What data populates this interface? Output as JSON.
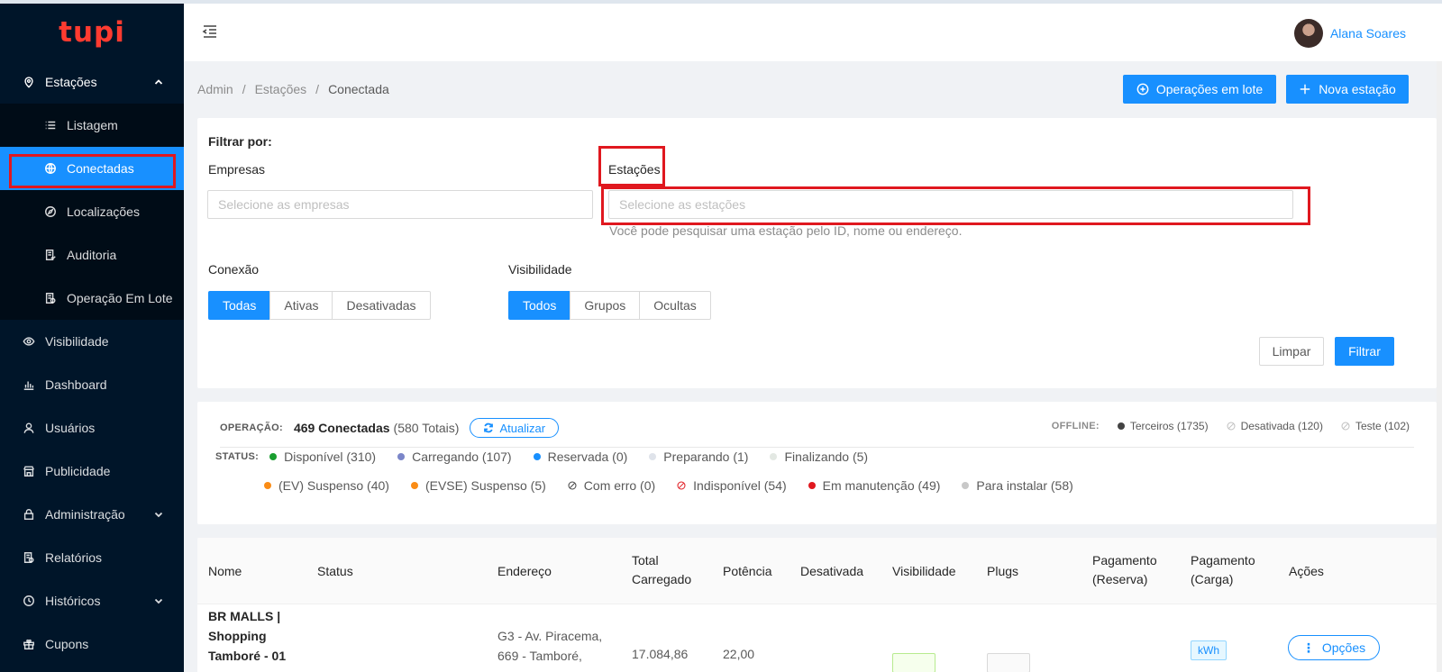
{
  "brand": {
    "logo_text": "tupi"
  },
  "sidebar": {
    "items": [
      {
        "label": "Estações",
        "icon": "location-pin-icon"
      },
      {
        "label": "Listagem",
        "icon": "list-icon"
      },
      {
        "label": "Conectadas",
        "icon": "globe-icon"
      },
      {
        "label": "Localizações",
        "icon": "compass-icon"
      },
      {
        "label": "Auditoria",
        "icon": "audit-doc-icon"
      },
      {
        "label": "Operação Em Lote",
        "icon": "batch-doc-icon"
      },
      {
        "label": "Visibilidade",
        "icon": "eye-icon"
      },
      {
        "label": "Dashboard",
        "icon": "bar-chart-icon"
      },
      {
        "label": "Usuários",
        "icon": "user-icon"
      },
      {
        "label": "Publicidade",
        "icon": "shop-icon"
      },
      {
        "label": "Administração",
        "icon": "lock-icon"
      },
      {
        "label": "Relatórios",
        "icon": "report-icon"
      },
      {
        "label": "Históricos",
        "icon": "history-icon"
      },
      {
        "label": "Cupons",
        "icon": "gift-icon"
      }
    ]
  },
  "header": {
    "user_name": "Alana Soares"
  },
  "breadcrumb": {
    "admin": "Admin",
    "sep": "/",
    "stations": "Estações",
    "current": "Conectada"
  },
  "actions": {
    "batch_ops": "Operações em lote",
    "new_station": "Nova estação"
  },
  "filter": {
    "title": "Filtrar por:",
    "companies_label": "Empresas",
    "companies_placeholder": "Selecione as empresas",
    "stations_label": "Estações",
    "stations_placeholder": "Selecione as estações",
    "stations_hint": "Você pode pesquisar uma estação pelo ID, nome ou endereço.",
    "connection_label": "Conexão",
    "connection_options": [
      "Todas",
      "Ativas",
      "Desativadas"
    ],
    "visibility_label": "Visibilidade",
    "visibility_options": [
      "Todos",
      "Grupos",
      "Ocultas"
    ],
    "clear": "Limpar",
    "apply": "Filtrar"
  },
  "operation": {
    "label": "OPERAÇÃO:",
    "connected": "469 Conectadas",
    "totals": "(580 Totais)",
    "refresh": "Atualizar",
    "offline_label": "OFFLINE:",
    "offline": [
      "Terceiros (1735)",
      "Desativada (120)",
      "Teste (102)"
    ]
  },
  "status": {
    "label": "STATUS:",
    "row1": [
      "Disponível (310)",
      "Carregando (107)",
      "Reservada (0)",
      "Preparando (1)",
      "Finalizando (5)"
    ],
    "row2": [
      "(EV) Suspenso (40)",
      "(EVSE) Suspenso (5)",
      "Com erro (0)",
      "Indisponível (54)",
      "Em manutenção (49)",
      "Para instalar (58)"
    ],
    "colors": {
      "available": "#1a9e2f",
      "charging": "#7b86c9",
      "reserved": "#1890ff",
      "preparing": "#dfe3ea",
      "finishing": "#e3e8e3",
      "ev_suspended": "#fa8c16",
      "evse_suspended": "#fa8c16",
      "error": "#595959",
      "unavailable": "#e0181f",
      "maintenance": "#e0181f",
      "to_install": "#c8c8c8"
    }
  },
  "table": {
    "headers": {
      "name": "Nome",
      "status": "Status",
      "address": "Endereço",
      "total_1": "Total",
      "total_2": "Carregado",
      "power": "Potência",
      "disabled": "Desativada",
      "visibility": "Visibilidade",
      "plugs": "Plugs",
      "pay_res_1": "Pagamento",
      "pay_res_2": "(Reserva)",
      "pay_charge_1": "Pagamento",
      "pay_charge_2": "(Carga)",
      "actions": "Ações"
    },
    "row": {
      "name_1": "BR MALLS |",
      "name_2": "Shopping",
      "name_3": "Tamboré - 01",
      "address_1": "G3 - Av. Piracema,",
      "address_2": "669 - Tamboré,",
      "total": "17.084,86",
      "power": "22,00",
      "pay_charge": "kWh",
      "options": "Opções"
    }
  }
}
